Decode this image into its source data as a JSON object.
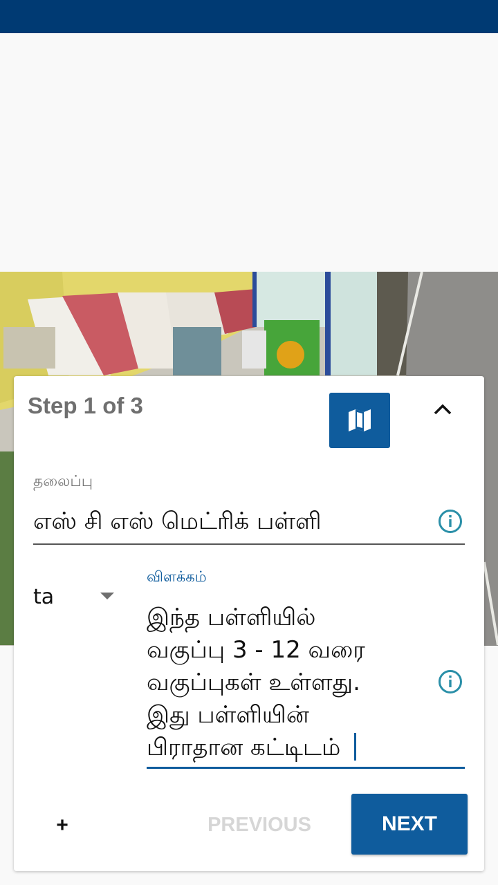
{
  "wizard": {
    "step_label": "Step 1 of 3",
    "map_icon": "map-icon",
    "collapse_icon": "chevron-up-icon"
  },
  "title_field": {
    "label": "தலைப்பு",
    "value": "எஸ் சி எஸ் மெட்ரிக் பள்ளி",
    "info_icon": "info-icon"
  },
  "language_select": {
    "value": "ta",
    "arrow_icon": "dropdown-arrow-icon"
  },
  "description_field": {
    "label": "விளக்கம்",
    "value": "இந்த பள்ளியில்\nவகுப்பு 3 - 12 வரை\nவகுப்புகள் உள்ளது.\nஇது பள்ளியின்\nபிராதான கட்டிடம்",
    "info_icon": "info-icon"
  },
  "actions": {
    "add_label": "+",
    "previous_label": "PREVIOUS",
    "next_label": "NEXT"
  },
  "colors": {
    "status_bar": "#003a73",
    "accent": "#0f5c9d",
    "info_icon": "#2a8fa8",
    "disabled_text": "#d6d6d6"
  }
}
